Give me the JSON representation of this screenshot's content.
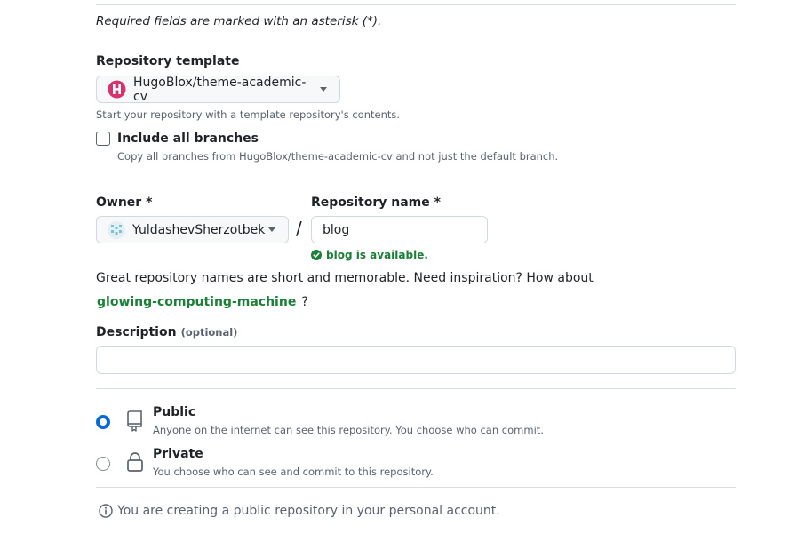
{
  "header": {
    "required_note": "Required fields are marked with an asterisk (*)."
  },
  "template": {
    "label": "Repository template",
    "value": "HugoBlox/theme-academic-cv",
    "icon": "hugoblox-logo-icon",
    "help": "Start your repository with a template repository's contents.",
    "include_branches_label": "Include all branches",
    "include_branches_help": "Copy all branches from HugoBlox/theme-academic-cv and not just the default branch.",
    "include_branches_checked": false
  },
  "owner": {
    "label": "Owner *",
    "value": "YuldashevSherzotbek",
    "avatar": "identicon-avatar"
  },
  "separator": "/",
  "repo_name": {
    "label": "Repository name *",
    "value": "blog",
    "status": "blog is available.",
    "status_color": "#1a7f37"
  },
  "inspiration": {
    "text": "Great repository names are short and memorable. Need inspiration? How about",
    "suggestion": "glowing-computing-machine",
    "suffix": "?"
  },
  "description": {
    "label": "Description",
    "optional": "(optional)",
    "value": ""
  },
  "visibility": {
    "selected": "public",
    "accent": "#0969da",
    "options": [
      {
        "title": "Public",
        "help": "Anyone on the internet can see this repository. You choose who can commit.",
        "icon": "repo-icon"
      },
      {
        "title": "Private",
        "help": "You choose who can see and commit to this repository.",
        "icon": "lock-icon"
      }
    ]
  },
  "info": {
    "icon": "info-icon",
    "text": "You are creating a public repository in your personal account."
  }
}
